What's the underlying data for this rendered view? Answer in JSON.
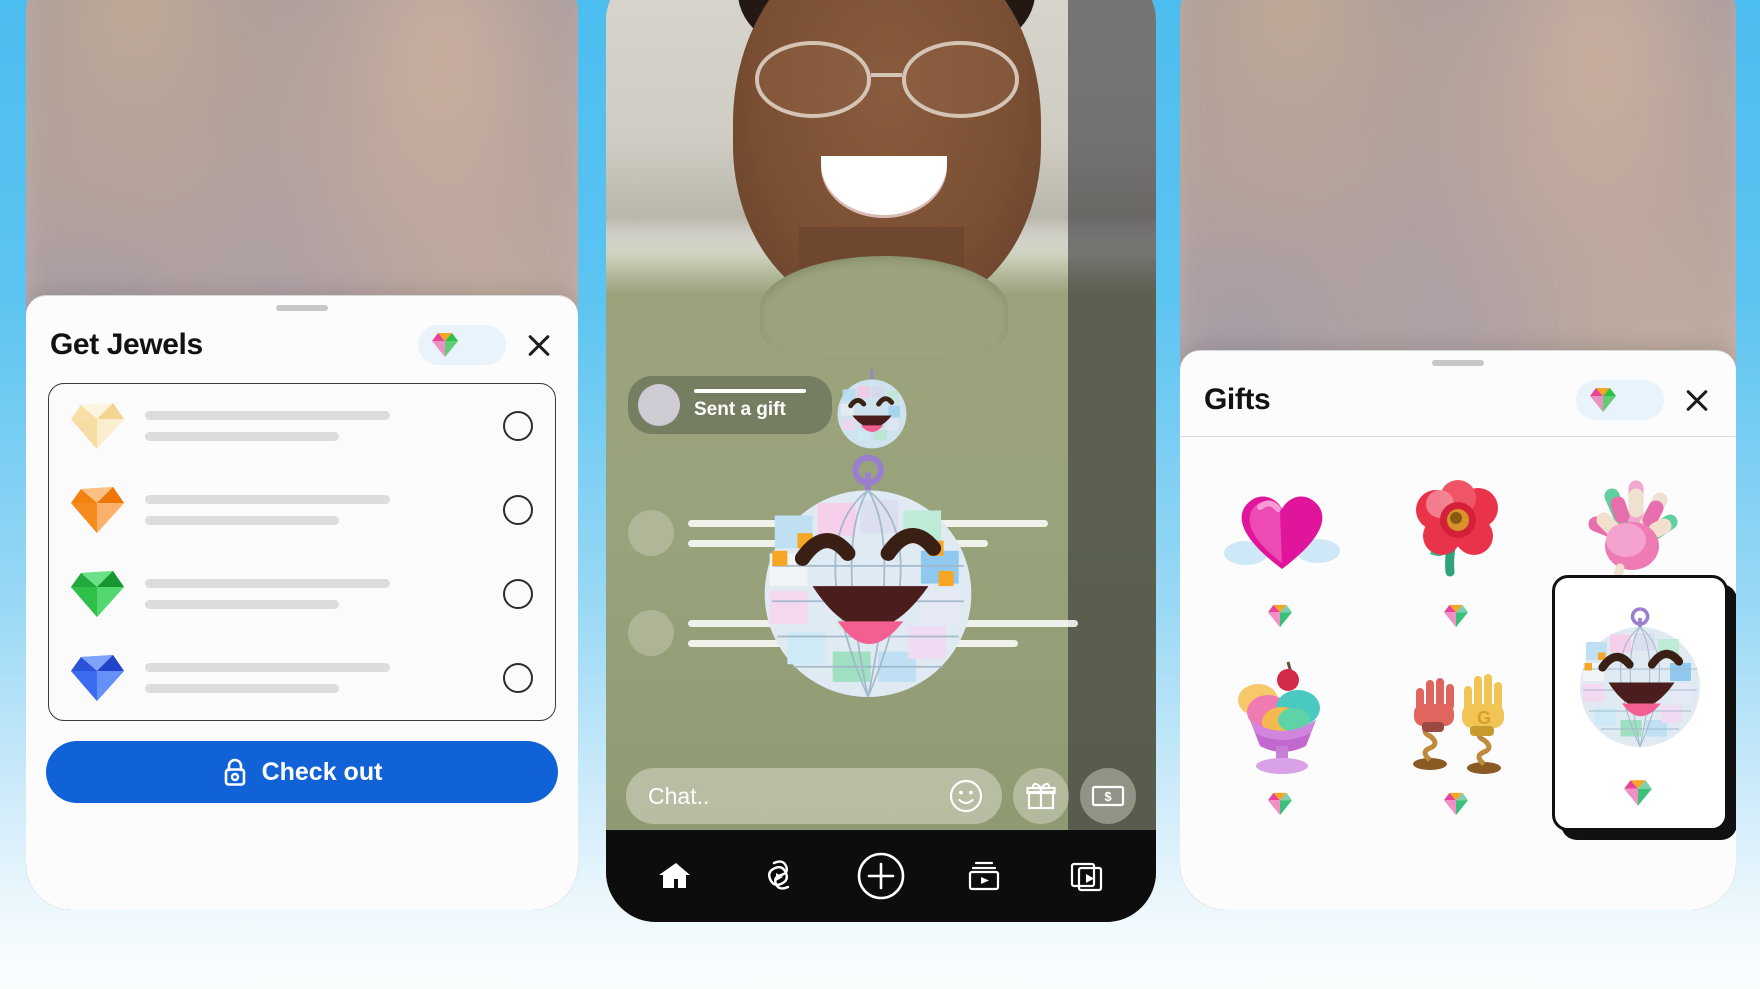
{
  "background": {
    "gradient_top": "#4cbdef",
    "gradient_bottom": "#fbfdfe"
  },
  "left_phone": {
    "sheet": {
      "title": "Get Jewels",
      "jewel_balance": "",
      "close_label": "Close",
      "jewel_icon": "gem-icon",
      "grabber": "drag-handle"
    },
    "jewel_packs": [
      {
        "tier": "pale",
        "color": "#f7e0b0",
        "name_placeholder": "",
        "price_placeholder": "",
        "selected": false
      },
      {
        "tier": "orange",
        "color": "#f58a1f",
        "name_placeholder": "",
        "price_placeholder": "",
        "selected": false
      },
      {
        "tier": "green",
        "color": "#2fc04a",
        "name_placeholder": "",
        "price_placeholder": "",
        "selected": false
      },
      {
        "tier": "blue",
        "color": "#3b6cf0",
        "name_placeholder": "",
        "price_placeholder": "",
        "selected": false
      }
    ],
    "checkout": {
      "label": "Check out",
      "icon": "lock-icon",
      "color": "#1162d6"
    }
  },
  "middle_phone": {
    "toast": {
      "label": "Sent a gift",
      "avatar": "user-avatar"
    },
    "overlay_gift": "disco-ball-gift",
    "chat": {
      "placeholder": "Chat..",
      "actions": [
        {
          "name": "emoji-button",
          "icon": "smiley-icon"
        },
        {
          "name": "gift-button",
          "icon": "gift-icon"
        },
        {
          "name": "money-button",
          "icon": "money-icon"
        }
      ]
    },
    "nav": [
      {
        "name": "home",
        "icon": "home-icon",
        "active": true
      },
      {
        "name": "reels",
        "icon": "reels-icon",
        "active": false
      },
      {
        "name": "create",
        "icon": "plus-circle-icon",
        "active": false
      },
      {
        "name": "library",
        "icon": "video-library-icon",
        "active": false
      },
      {
        "name": "watch",
        "icon": "watch-video-icon",
        "active": false
      }
    ]
  },
  "right_phone": {
    "sheet": {
      "title": "Gifts",
      "jewel_balance": "",
      "close_label": "Close",
      "jewel_icon": "gem-icon",
      "grabber": "drag-handle"
    },
    "gifts": [
      {
        "name": "heart-with-clouds",
        "price_placeholder": "",
        "selected": false
      },
      {
        "name": "red-poppy-flower",
        "price_placeholder": "",
        "selected": false
      },
      {
        "name": "candy-hand",
        "price_placeholder": "",
        "selected": false
      },
      {
        "name": "ice-cream-sundae",
        "price_placeholder": "",
        "selected": false
      },
      {
        "name": "clapping-hands",
        "price_placeholder": "",
        "selected": false
      },
      {
        "name": "disco-ball",
        "price_placeholder": "",
        "selected": true
      }
    ]
  }
}
